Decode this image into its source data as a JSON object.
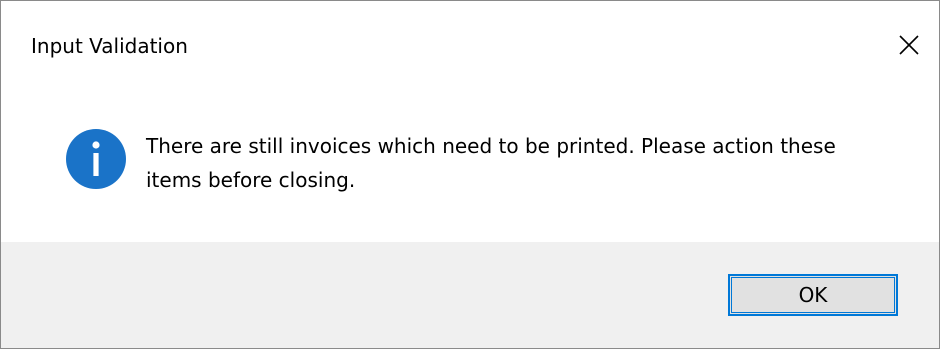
{
  "dialog": {
    "title": "Input Validation",
    "message": "There are still invoices which need to be printed. Please action these items before closing.",
    "icon": "info-icon",
    "ok_label": "OK",
    "close_icon": "close-icon"
  },
  "colors": {
    "icon_blue": "#1a73c8",
    "button_border": "#0078d7",
    "footer_bg": "#f0f0f0",
    "button_bg": "#e1e1e1"
  }
}
